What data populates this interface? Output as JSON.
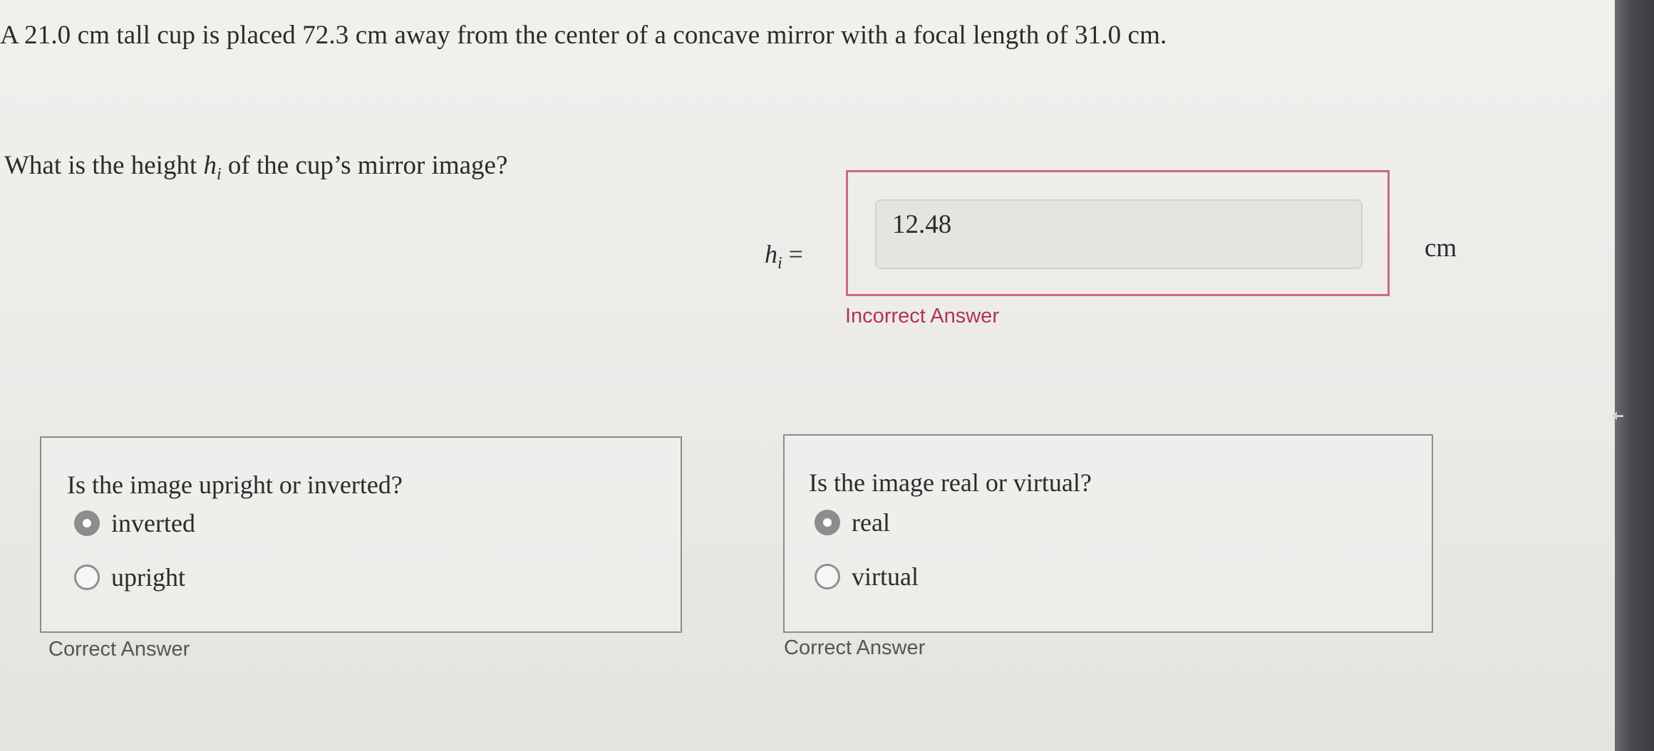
{
  "problem": {
    "statement": "A 21.0 cm tall cup is placed 72.3 cm away from the center of a concave mirror with a focal length of 31.0 cm."
  },
  "height_question": {
    "text_before": "What is the height ",
    "symbol": "h",
    "subscript": "i",
    "text_after": " of the cup’s mirror image?"
  },
  "answer": {
    "label_symbol": "h",
    "label_subscript": "i",
    "label_equals": " =",
    "value": "12.48",
    "unit": "cm",
    "feedback": "Incorrect Answer",
    "feedback_color": "#b5334f"
  },
  "orientation_question": {
    "prompt": "Is the image upright or inverted?",
    "options": [
      {
        "label": "inverted",
        "selected": true
      },
      {
        "label": "upright",
        "selected": false
      }
    ],
    "feedback": "Correct Answer"
  },
  "nature_question": {
    "prompt": "Is the image real or virtual?",
    "options": [
      {
        "label": "real",
        "selected": true
      },
      {
        "label": "virtual",
        "selected": false
      }
    ],
    "feedback": "Correct Answer"
  },
  "colors": {
    "incorrect_border": "#c9697f",
    "incorrect_text": "#b5334f",
    "selected_radio": "#8d8d8d"
  }
}
